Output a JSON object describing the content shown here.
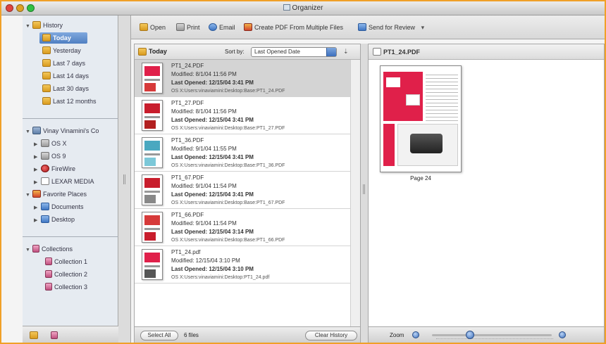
{
  "window": {
    "title": "Organizer",
    "traffic_lights": [
      "#e0443e",
      "#dea123",
      "#30c142"
    ]
  },
  "sidebar": {
    "history": {
      "label": "History",
      "items": [
        "Today",
        "Yesterday",
        "Last 7 days",
        "Last 14 days",
        "Last 30 days",
        "Last 12 months"
      ],
      "selected": "Today"
    },
    "computer": {
      "label": "Vinay Vinamini's Co",
      "items": [
        "OS X",
        "OS 9",
        "FireWire",
        "LEXAR MEDIA"
      ]
    },
    "favorites": {
      "label": "Favorite Places",
      "items": [
        "Documents",
        "Desktop"
      ]
    },
    "collections": {
      "label": "Collections",
      "items": [
        "Collection 1",
        "Collection 2",
        "Collection 3"
      ]
    }
  },
  "toolbar": {
    "open": "Open",
    "print": "Print",
    "email": "Email",
    "create_pdf": "Create PDF From Multiple Files",
    "send_review": "Send for Review",
    "send_review_arrow": "▾"
  },
  "list": {
    "title": "Today",
    "sort_label": "Sort by:",
    "sort_value": "Last Opened Date",
    "files": [
      {
        "name": "PT1_24.PDF",
        "modified": "Modified: 8/1/04 11:56 PM",
        "opened_label": "Last Opened:",
        "opened_value": "12/15/04 3:41 PM",
        "path": "OS X:Users:vinaviamini:Desktop:Base:PT1_24.PDF"
      },
      {
        "name": "PT1_27.PDF",
        "modified": "Modified: 8/1/04 11:56 PM",
        "opened_label": "Last Opened:",
        "opened_value": "12/15/04 3:41 PM",
        "path": "OS X:Users:vinaviamini:Desktop:Base:PT1_27.PDF"
      },
      {
        "name": "PT1_36.PDF",
        "modified": "Modified: 9/1/04 11:55 PM",
        "opened_label": "Last Opened:",
        "opened_value": "12/15/04 3:41 PM",
        "path": "OS X:Users:vinaviamini:Desktop:Base:PT1_36.PDF"
      },
      {
        "name": "PT1_67.PDF",
        "modified": "Modified: 9/1/04 11:54 PM",
        "opened_label": "Last Opened:",
        "opened_value": "12/15/04 3:41 PM",
        "path": "OS X:Users:vinaviamini:Desktop:Base:PT1_67.PDF"
      },
      {
        "name": "PT1_66.PDF",
        "modified": "Modified: 9/1/04 11:54 PM",
        "opened_label": "Last Opened:",
        "opened_value": "12/15/04 3:14 PM",
        "path": "OS X:Users:vinaviamini:Desktop:Base:PT1_66.PDF"
      },
      {
        "name": "PT1_24.pdf",
        "modified": "Modified: 12/15/04 3:10 PM",
        "opened_label": "Last Opened:",
        "opened_value": "12/15/04 3:10 PM",
        "path": "OS X:Users:vinaviamini:Desktop:PT1_24.pdf"
      }
    ],
    "select_all": "Select All",
    "file_count": "6 files",
    "clear_history": "Clear History"
  },
  "preview": {
    "title": "PT1_24.PDF",
    "page_label": "Page 24",
    "zoom_label": "Zoom",
    "zoom_level": 0.32
  },
  "colors": {
    "frame_border": "#f0a028",
    "selection": "#4f7fc1",
    "thumb_red": "#e0204a"
  }
}
